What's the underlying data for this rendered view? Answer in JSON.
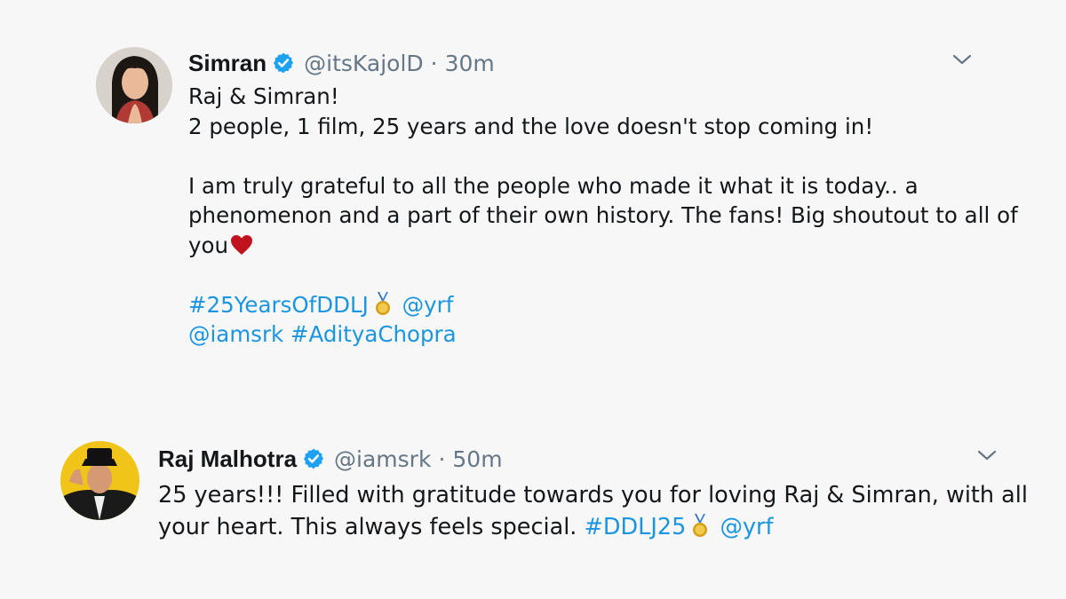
{
  "tweets": [
    {
      "name": "Simran",
      "handle": "@itsKajolD",
      "sep": "·",
      "time": "30m",
      "avatar_icon": "avatar-photo-woman",
      "text_lines": {
        "l1": "Raj & Simran!",
        "l2": "2 people, 1 film, 25 years and the love doesn't stop coming in!",
        "l3": "I am truly grateful to all the people who made it what it is today.. a",
        "l4": "phenomenon and a part of their own history. The fans! Big shoutout to all of",
        "l5": "you"
      },
      "emoji_heart": "red-heart-icon",
      "links": {
        "hashtag1": "#25YearsOfDDLJ",
        "mention1": "@yrf",
        "mention2": "@iamsrk",
        "hashtag2": "#AdityaChopra"
      }
    },
    {
      "name": "Raj Malhotra",
      "handle": "@iamsrk",
      "sep": "·",
      "time": "50m",
      "avatar_icon": "avatar-photo-man-hat",
      "text_lines": {
        "l1": "25 years!!! Filled with gratitude towards you for loving Raj & Simran, with all",
        "l2": "your heart. This always feels special."
      },
      "links": {
        "hashtag1": "#DDLJ25",
        "mention1": "@yrf"
      }
    }
  ],
  "colors": {
    "background": "#f7f7f7",
    "link": "#1b95e0",
    "secondary_text": "#657786",
    "verified_badge": "#1da1f2"
  }
}
